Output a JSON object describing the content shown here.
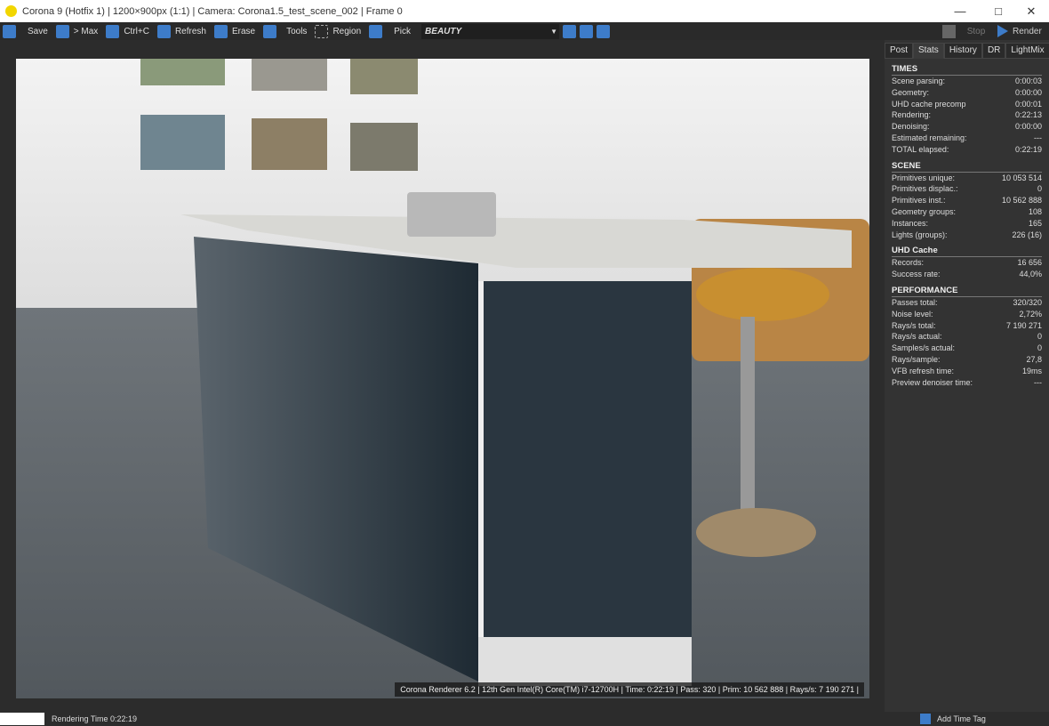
{
  "window": {
    "title": "Corona 9 (Hotfix 1) | 1200×900px (1:1) | Camera: Corona1.5_test_scene_002 | Frame 0"
  },
  "toolbar": {
    "save": "Save",
    "max": "> Max",
    "copy": "Ctrl+C",
    "refresh": "Refresh",
    "erase": "Erase",
    "tools": "Tools",
    "region": "Region",
    "pick": "Pick",
    "channel": "BEAUTY",
    "stop": "Stop",
    "render": "Render"
  },
  "tabs": [
    "Post",
    "Stats",
    "History",
    "DR",
    "LightMix"
  ],
  "stats": {
    "times": {
      "title": "TIMES",
      "rows": [
        [
          "Scene parsing:",
          "0:00:03"
        ],
        [
          "Geometry:",
          "0:00:00"
        ],
        [
          "UHD cache precomp",
          "0:00:01"
        ],
        [
          "Rendering:",
          "0:22:13"
        ],
        [
          "Denoising:",
          "0:00:00"
        ],
        [
          "Estimated remaining:",
          "---"
        ],
        [
          "TOTAL elapsed:",
          "0:22:19"
        ]
      ]
    },
    "scene": {
      "title": "SCENE",
      "rows": [
        [
          "Primitives unique:",
          "10 053 514"
        ],
        [
          "Primitives displac.:",
          "0"
        ],
        [
          "Primitives inst.:",
          "10 562 888"
        ],
        [
          "Geometry groups:",
          "108"
        ],
        [
          "Instances:",
          "165"
        ],
        [
          "Lights (groups):",
          "226 (16)"
        ]
      ]
    },
    "uhd": {
      "title": "UHD Cache",
      "rows": [
        [
          "Records:",
          "16 656"
        ],
        [
          "Success rate:",
          "44,0%"
        ]
      ]
    },
    "perf": {
      "title": "PERFORMANCE",
      "rows": [
        [
          "Passes total:",
          "320/320"
        ],
        [
          "Noise level:",
          "2,72%"
        ],
        [
          "Rays/s total:",
          "7 190 271"
        ],
        [
          "Rays/s actual:",
          "0"
        ],
        [
          "Samples/s actual:",
          "0"
        ],
        [
          "Rays/sample:",
          "27,8"
        ],
        [
          "VFB refresh time:",
          "19ms"
        ],
        [
          "Preview denoiser time:",
          "---"
        ]
      ]
    }
  },
  "render_stamp": "Corona Renderer 6.2 | 12th Gen Intel(R) Core(TM) i7-12700H | Time: 0:22:19 | Pass: 320 | Prim: 10 562 888 | Rays/s: 7 190 271 |",
  "status": {
    "rendering_time": "Rendering Time  0:22:19",
    "add_time_tag": "Add Time Tag"
  }
}
